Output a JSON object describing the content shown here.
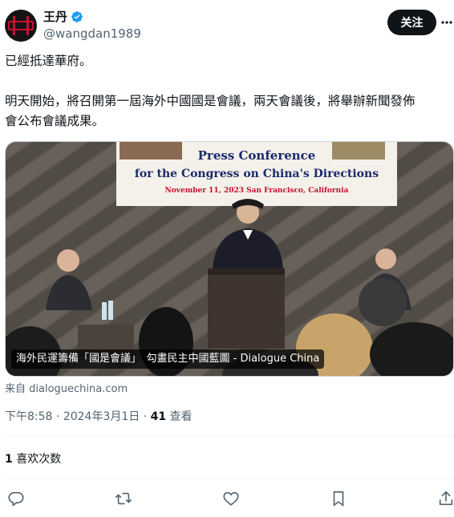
{
  "author": {
    "name": "王丹",
    "handle": "@wangdan1989"
  },
  "follow_label": "关注",
  "tweet": {
    "line1": "已經抵達華府。",
    "line2": "明天開始，將召開第一屆海外中國國是會議，兩天會議後，將舉辦新聞發佈",
    "line3": "會公布會議成果。"
  },
  "card": {
    "title": "海外民運籌備「國是會議」　勾畫民主中國藍圖 - Dialogue China",
    "source": "来自 dialoguechina.com",
    "banner_line1": "Press Conference",
    "banner_line2": "for the Congress on China's Directions",
    "banner_line3": "November 11, 2023   San Francisco, California"
  },
  "meta": {
    "time": "下午8:58",
    "sep1": " · ",
    "date": "2024年3月1日",
    "sep2": " · ",
    "views_count": "41",
    "views_label": " 查看"
  },
  "stats": {
    "likes_count": "1",
    "likes_label": " 喜欢次数"
  },
  "icons": [
    "verified-icon",
    "more-icon",
    "reply-icon",
    "retweet-icon",
    "like-icon",
    "bookmark-icon",
    "share-icon"
  ],
  "colors": {
    "accent": "#1d9bf0",
    "text": "#0f1419",
    "muted": "#536471",
    "banner_red": "#c8102e",
    "banner_blue": "#1a2a6c"
  }
}
